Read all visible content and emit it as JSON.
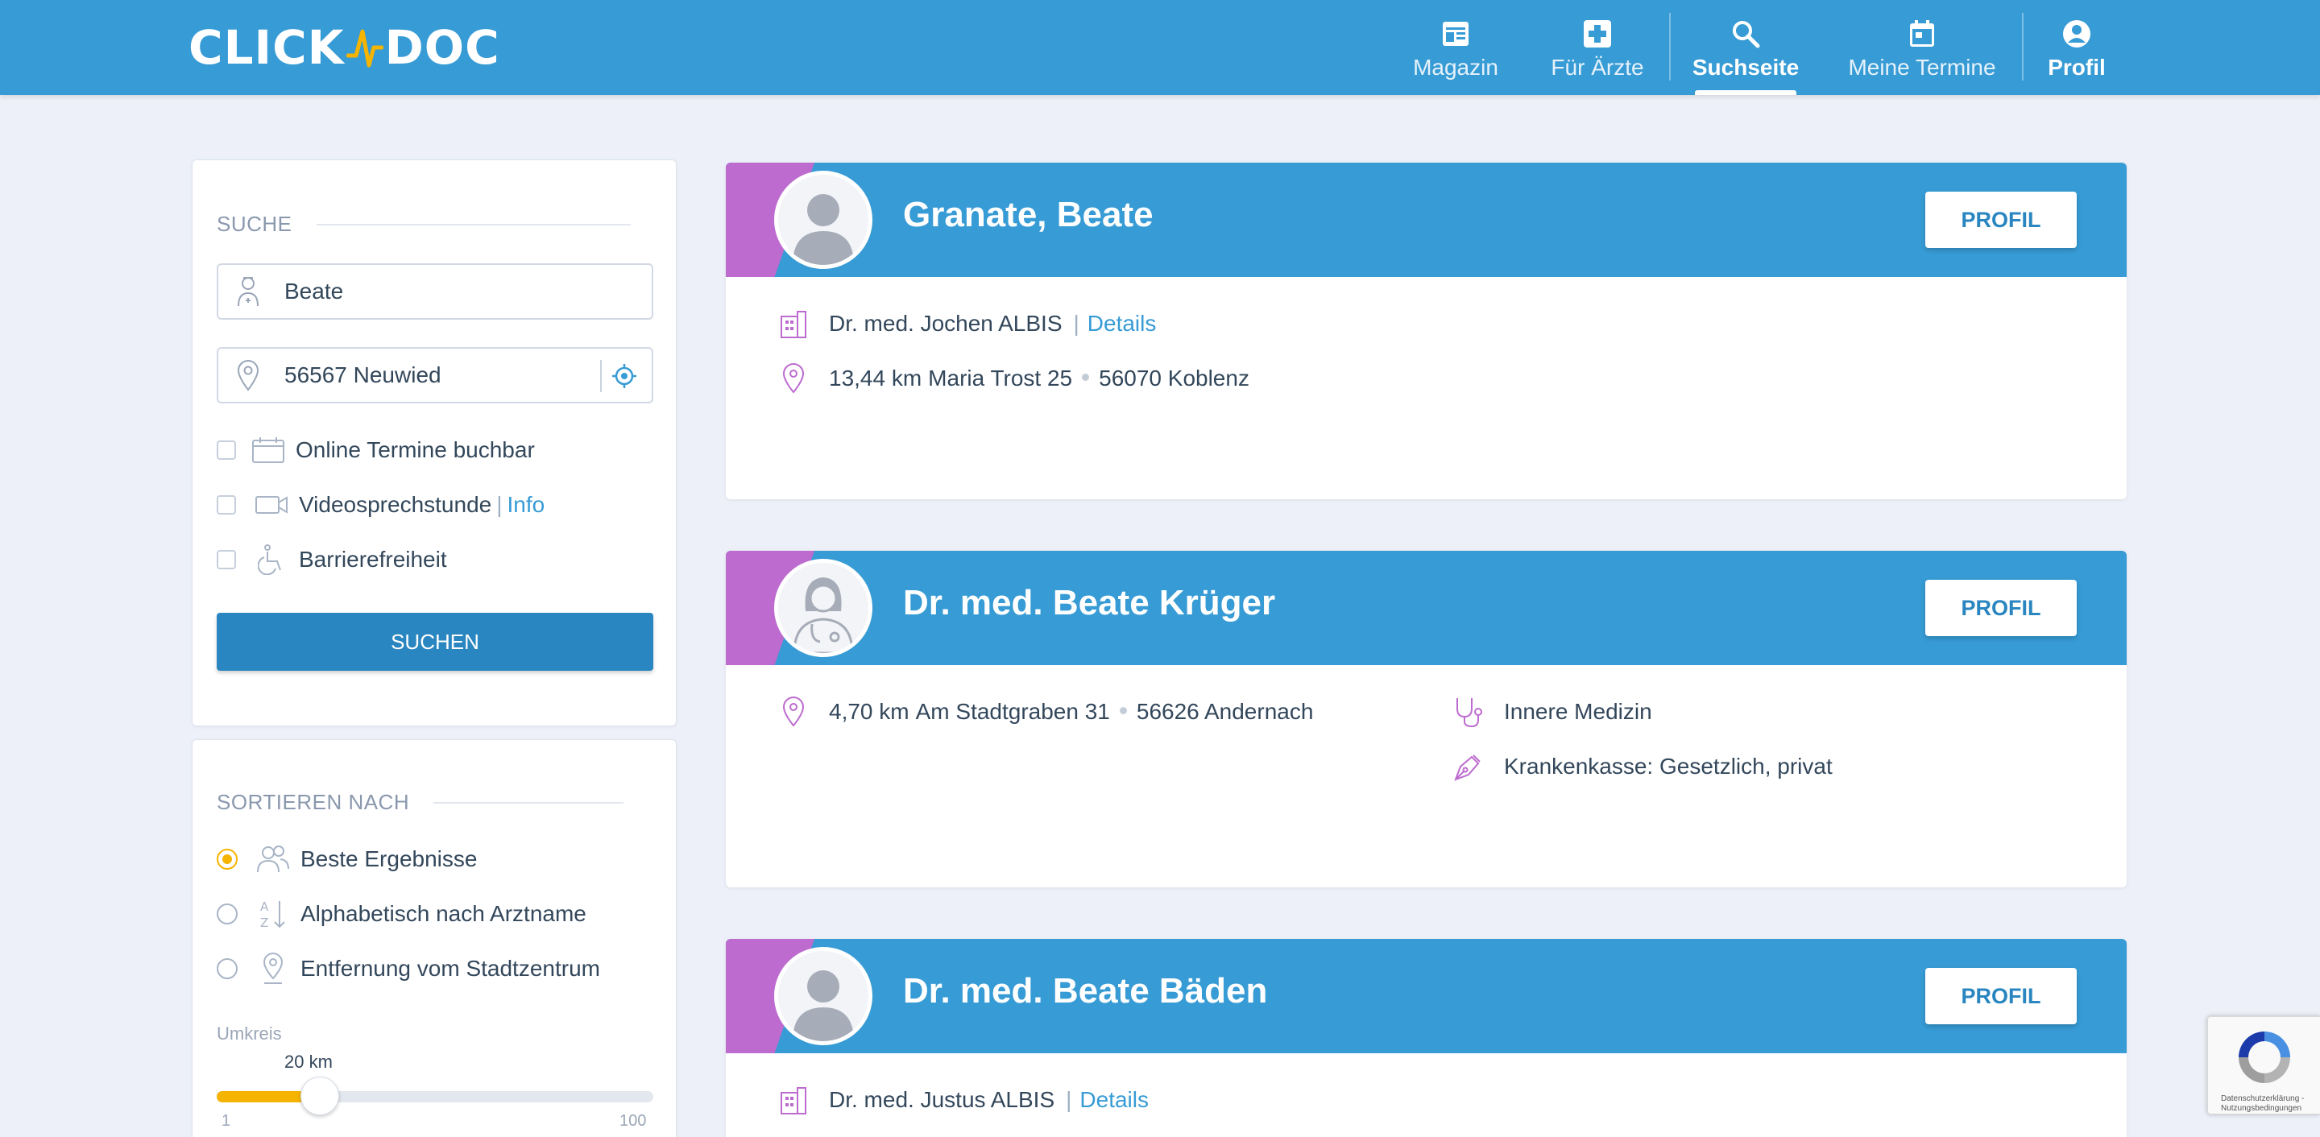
{
  "header": {
    "logo_left": "CLICK",
    "logo_right": "DOC",
    "nav": [
      {
        "label": "Magazin",
        "icon": "newspaper-icon"
      },
      {
        "label": "Für Ärzte",
        "icon": "medical-cross-icon"
      },
      {
        "label": "Suchseite",
        "icon": "search-icon",
        "active": true
      },
      {
        "label": "Meine Termine",
        "icon": "calendar-icon"
      },
      {
        "label": "Profil",
        "icon": "user-circle-icon"
      }
    ]
  },
  "search_panel": {
    "title": "SUCHE",
    "name_value": "Beate",
    "location_value": "56567 Neuwied",
    "filters": [
      {
        "label": "Online Termine buchbar",
        "icon": "calendar-outline-icon"
      },
      {
        "label": "Videosprechstunde",
        "icon": "video-camera-icon",
        "link": "Info"
      },
      {
        "label": "Barrierefreiheit",
        "icon": "wheelchair-icon"
      }
    ],
    "button": "SUCHEN"
  },
  "sort_panel": {
    "title": "SORTIEREN NACH",
    "options": [
      {
        "label": "Beste Ergebnisse",
        "icon": "users-icon",
        "selected": true
      },
      {
        "label": "Alphabetisch nach Arztname",
        "icon": "sort-az-icon",
        "selected": false
      },
      {
        "label": "Entfernung vom Stadtzentrum",
        "icon": "map-pin-icon",
        "selected": false
      }
    ],
    "radius_label": "Umkreis",
    "radius_value": "20 km",
    "radius_level": 20,
    "radius_min": "1",
    "radius_max": "100"
  },
  "results": [
    {
      "name": "Granate, Beate",
      "button": "PROFIL",
      "practice": "Dr. med. Jochen ALBIS",
      "details": "Details",
      "distance": "13,44 km",
      "street": "Maria Trost 25",
      "city": "56070 Koblenz"
    },
    {
      "name": "Dr. med. Beate Krüger",
      "button": "PROFIL",
      "distance": "4,70 km",
      "street": "Am Stadtgraben 31",
      "city": "56626 Andernach",
      "specialty": "Innere Medizin",
      "insurance": "Krankenkasse: Gesetzlich, privat"
    },
    {
      "name": "Dr. med. Beate Bäden",
      "button": "PROFIL",
      "practice": "Dr. med. Justus ALBIS",
      "details": "Details"
    }
  ],
  "recaptcha": {
    "line1": "Datenschutzerklärung -",
    "line2": "Nutzungsbedingungen"
  },
  "colors": {
    "primary": "#379bd5",
    "accent_purple": "#bd6bcf",
    "accent_yellow": "#f5b400",
    "button_blue": "#2a86c0"
  }
}
